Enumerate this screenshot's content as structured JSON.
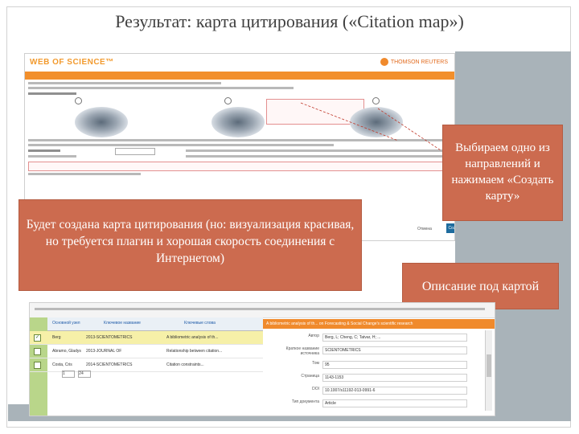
{
  "slide": {
    "title": "Результат: карта цитирования («Citation map»)"
  },
  "screenshot_top": {
    "logo": "WEB OF SCIENCE™",
    "brand": "THOMSON REUTERS",
    "cancel_label": "Отмена",
    "create_label": "Создать карту"
  },
  "callouts": {
    "choose_direction": "Выбираем одно из направлений и нажимаем «Создать карту»",
    "map_note": "Будет создана карта цитирования (но: визуализация красивая, но требуется плагин и хорошая скорость соединения с Интернетом)",
    "description": "Описание под картой"
  },
  "screenshot_bottom": {
    "table_headers": [
      "Основной узел",
      "Ключевое название",
      "Ключевые слова"
    ],
    "rows": [
      {
        "c1": "Berg",
        "c2": "2013-SCIENTOMETRICS",
        "c3": "A bibliometric analysis of th...",
        "checked": true,
        "highlight": true
      },
      {
        "c1": "Abramo, Gladys",
        "c2": "2013-JOURNAL OF",
        "c3": "Relationship between citation...",
        "checked": false,
        "highlight": false
      },
      {
        "c1": "Costa, Cris",
        "c2": "2014-SCIENTOMETRICS",
        "c3": "Citation constraints...",
        "checked": false,
        "highlight": false
      }
    ],
    "pager_page": "1",
    "pager_size": "24",
    "detail_title": "A bibliometric analysis of th... on Forecasting & Social Change's scientific research",
    "detail_rows": [
      {
        "k": "Автор",
        "v": "Berg, L; Cheng, C; Tatvar, H; ..."
      },
      {
        "k": "Краткое название источника",
        "v": "SCIENTOMETRICS"
      },
      {
        "k": "Том",
        "v": "95"
      },
      {
        "k": "Страница",
        "v": "1143-1153"
      },
      {
        "k": "DOI",
        "v": "10.1007/s11192-013-0991-6"
      },
      {
        "k": "Тип документа",
        "v": "Article"
      }
    ]
  },
  "colors": {
    "callout_fill": "#cc6b4f",
    "wos_orange": "#f28f2b",
    "panel_gray": "#a9b3b9"
  }
}
